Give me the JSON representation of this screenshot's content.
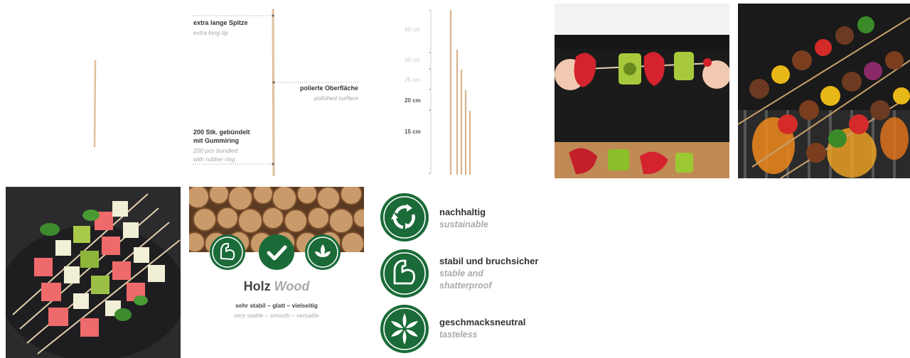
{
  "colors": {
    "brand_green": "#1a6b38",
    "wood": "#d9b38c"
  },
  "tile2": {
    "tip_de": "extra lange Spitze",
    "tip_en": "extra long tip",
    "surface_de": "polierte Oberfläche",
    "surface_en": "polished surface",
    "bundle_de_1": "200 Stk. gebündelt",
    "bundle_de_2": "mit Gummiring",
    "bundle_en_1": "200 pcs bundled",
    "bundle_en_2": "with rubber ring"
  },
  "tile3": {
    "sizes": [
      "40 cm",
      "30 cm",
      "25 cm",
      "20 cm",
      "15 cm"
    ]
  },
  "wood_card": {
    "title_de": "Holz",
    "title_en": "Wood",
    "props_de": "sehr stabil – glatt – vielseitig",
    "props_en": "very stable – smooth – versatile",
    "icons": [
      "arm-icon",
      "check-icon",
      "leaf-icon"
    ]
  },
  "features": [
    {
      "de": "nachhaltig",
      "en": "sustainable",
      "icon": "recycle-icon"
    },
    {
      "de": "stabil und bruchsicher",
      "en_1": "stable and",
      "en_2": "shatterproof",
      "icon": "arm-icon"
    },
    {
      "de": "geschmacksneutral",
      "en": "tasteless",
      "icon": "flower-icon"
    }
  ]
}
